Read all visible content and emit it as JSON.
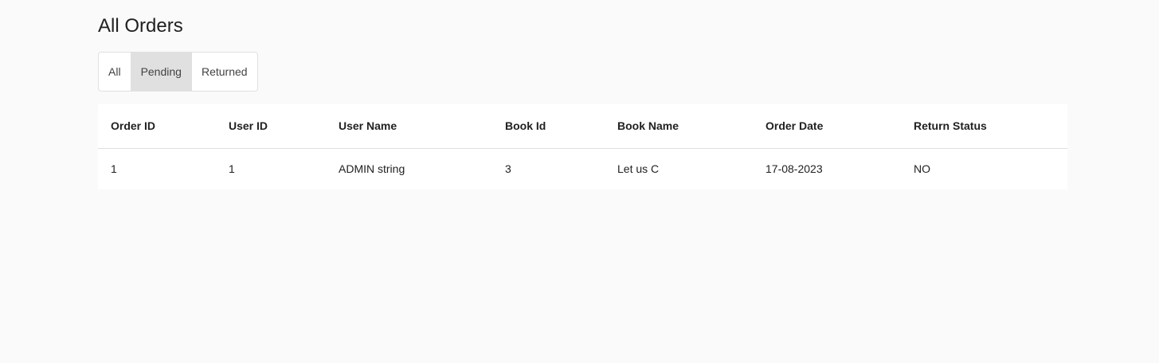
{
  "page": {
    "title": "All Orders"
  },
  "filters": {
    "options": [
      {
        "label": "All"
      },
      {
        "label": "Pending"
      },
      {
        "label": "Returned"
      }
    ],
    "selected": "Pending"
  },
  "table": {
    "columns": [
      "Order ID",
      "User ID",
      "User Name",
      "Book Id",
      "Book Name",
      "Order Date",
      "Return Status"
    ],
    "rows": [
      [
        "1",
        "1",
        "ADMIN string",
        "3",
        "Let us C",
        "17-08-2023",
        "NO"
      ]
    ]
  },
  "colors": {
    "background": "#fafafa",
    "selected_toggle": "#e0e0e0",
    "table_background": "#ffffff"
  }
}
